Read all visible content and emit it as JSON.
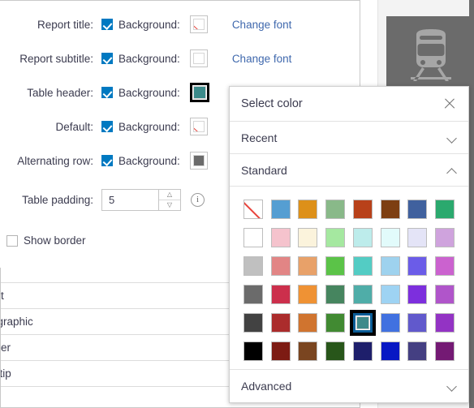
{
  "settings": {
    "rows": [
      {
        "label": "Report title:",
        "checkbox_label": "Background:",
        "checked": true,
        "swatch": "none",
        "swatch_color": "",
        "link": "Change font"
      },
      {
        "label": "Report subtitle:",
        "checkbox_label": "Background:",
        "checked": true,
        "swatch": "color",
        "swatch_color": "#ffffff",
        "link": "Change font"
      },
      {
        "label": "Table header:",
        "checkbox_label": "Background:",
        "checked": true,
        "swatch": "color",
        "swatch_color": "#3b8a8a",
        "link": ""
      },
      {
        "label": "Default:",
        "checkbox_label": "Background:",
        "checked": true,
        "swatch": "none",
        "swatch_color": "",
        "link": ""
      },
      {
        "label": "Alternating row:",
        "checkbox_label": "Background:",
        "checked": true,
        "swatch": "color",
        "swatch_color": "#6b6b6b",
        "link": ""
      }
    ],
    "padding": {
      "label": "Table padding:",
      "value": "5",
      "up_icon": "chevron-up-icon",
      "down_icon": "chevron-down-icon",
      "info_icon": "info-icon",
      "info_glyph": "i"
    },
    "show_border": {
      "label": "Show border",
      "checked": false
    }
  },
  "list": {
    "items": [
      "art",
      "ographic",
      "rder",
      "oltip"
    ]
  },
  "preview": {
    "icon": "train-icon"
  },
  "picker": {
    "title": "Select color",
    "close_icon": "close-icon",
    "sections": [
      {
        "label": "Recent",
        "expanded": false,
        "chevron": "chevron-down-icon"
      },
      {
        "label": "Standard",
        "expanded": true,
        "chevron": "chevron-up-icon"
      },
      {
        "label": "Advanced",
        "expanded": false,
        "chevron": "chevron-down-icon"
      }
    ],
    "selected_color": "#3f8a8a",
    "selected_index": 36,
    "standard_colors": [
      "none",
      "#559ed2",
      "#dd9019",
      "#89b989",
      "#b8411a",
      "#7d3f12",
      "#40619e",
      "#2ba96e",
      "#ffffff",
      "#f5c3cd",
      "#fbf3dc",
      "#a5e8a0",
      "#bdeceb",
      "#e2fbfb",
      "#e4e4f7",
      "#cfa3dd",
      "#c0c0c0",
      "#e28585",
      "#e8a169",
      "#5bc348",
      "#53ccc4",
      "#9ed2ee",
      "#6b5ce8",
      "#cb62cf",
      "#6b6b6b",
      "#cc2f4c",
      "#ef9234",
      "#46855f",
      "#4fada8",
      "#9ed3f3",
      "#7d2fdd",
      "#b055ca",
      "#424242",
      "#ab2c2c",
      "#d0742f",
      "#418a32",
      "#3f8a8a",
      "#4171e0",
      "#6159cc",
      "#9333c4",
      "#000000",
      "#7d1b13",
      "#7a4520",
      "#28561a",
      "#1e1f6b",
      "#0718c4",
      "#443f82",
      "#741a74"
    ]
  }
}
